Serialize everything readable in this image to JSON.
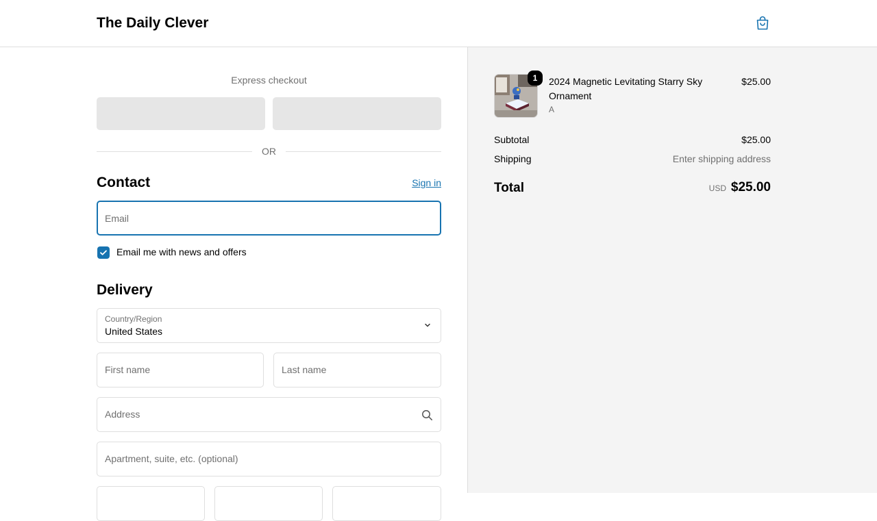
{
  "header": {
    "brand": "The Daily Clever",
    "cart_icon": "shopping-bag-icon"
  },
  "express": {
    "title": "Express checkout",
    "divider": "OR"
  },
  "contact": {
    "title": "Contact",
    "sign_in": "Sign in",
    "email_placeholder": "Email",
    "newsletter_label": "Email me with news and offers",
    "newsletter_checked": true
  },
  "delivery": {
    "title": "Delivery",
    "country_label": "Country/Region",
    "country_value": "United States",
    "first_name_placeholder": "First name",
    "last_name_placeholder": "Last name",
    "address_placeholder": "Address",
    "apartment_placeholder": "Apartment, suite, etc. (optional)"
  },
  "summary": {
    "item": {
      "quantity": "1",
      "name": "2024 Magnetic Levitating Starry Sky Ornament",
      "variant": "A",
      "price": "$25.00"
    },
    "subtotal_label": "Subtotal",
    "subtotal_value": "$25.00",
    "shipping_label": "Shipping",
    "shipping_value": "Enter shipping address",
    "total_label": "Total",
    "currency": "USD",
    "total_value": "$25.00"
  },
  "colors": {
    "accent": "#1773b0",
    "panel_bg": "#f4f4f4",
    "muted_text": "#707070"
  }
}
